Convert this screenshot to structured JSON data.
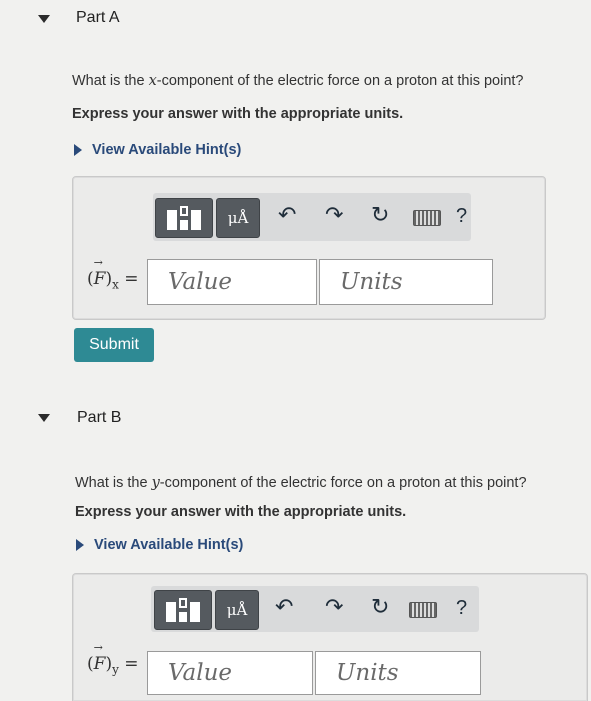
{
  "partA": {
    "title": "Part A",
    "question_pre": "What is the ",
    "question_var": "x",
    "question_post": "-component of the electric force on a proton at this point?",
    "instruction": "Express your answer with the appropriate units.",
    "hint": "View Available Hint(s)",
    "lhs_symbol": "F",
    "lhs_sub": "x",
    "lhs_eq": "=",
    "value_placeholder": "Value",
    "units_placeholder": "Units",
    "submit_label": "Submit"
  },
  "partB": {
    "title": "Part B",
    "question_pre": "What is the ",
    "question_var": "y",
    "question_post": "-component of the electric force on a proton at this point?",
    "instruction": "Express your answer with the appropriate units.",
    "hint": "View Available Hint(s)",
    "lhs_symbol": "F",
    "lhs_sub": "y",
    "lhs_eq": "=",
    "value_placeholder": "Value",
    "units_placeholder": "Units"
  },
  "toolbar": {
    "units_button": "μÅ",
    "undo_glyph": "↶",
    "redo_glyph": "↷",
    "reset_glyph": "↻",
    "help_glyph": "?"
  },
  "icons": [
    "caret-down-icon",
    "template-icon",
    "undo-icon",
    "redo-icon",
    "reset-icon",
    "keyboard-icon",
    "help-icon"
  ]
}
